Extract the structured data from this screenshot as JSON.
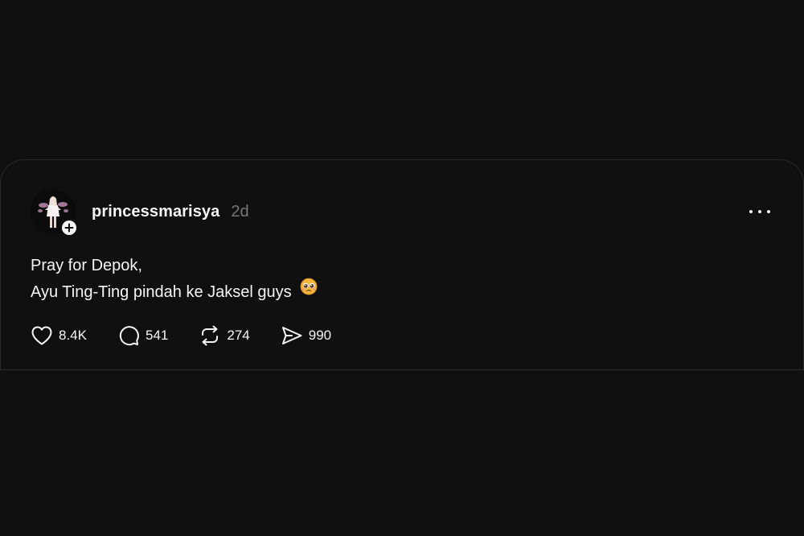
{
  "post": {
    "username": "princessmarisya",
    "timestamp": "2d",
    "text_lines": [
      "Pray for Depok,",
      "Ayu Ting-Ting pindah ke Jaksel guys"
    ],
    "emoji": "pleading-face-emoji",
    "actions": {
      "likes": "8.4K",
      "replies": "541",
      "reposts": "274",
      "shares": "990"
    },
    "icons": {
      "follow": "plus-icon",
      "more": "more-icon",
      "like": "heart-icon",
      "reply": "comment-icon",
      "repost": "repost-icon",
      "share": "send-icon"
    }
  },
  "colors": {
    "background": "#101010",
    "text": "#f3f5f7",
    "muted": "#777777",
    "divider": "#2e2e2e"
  }
}
